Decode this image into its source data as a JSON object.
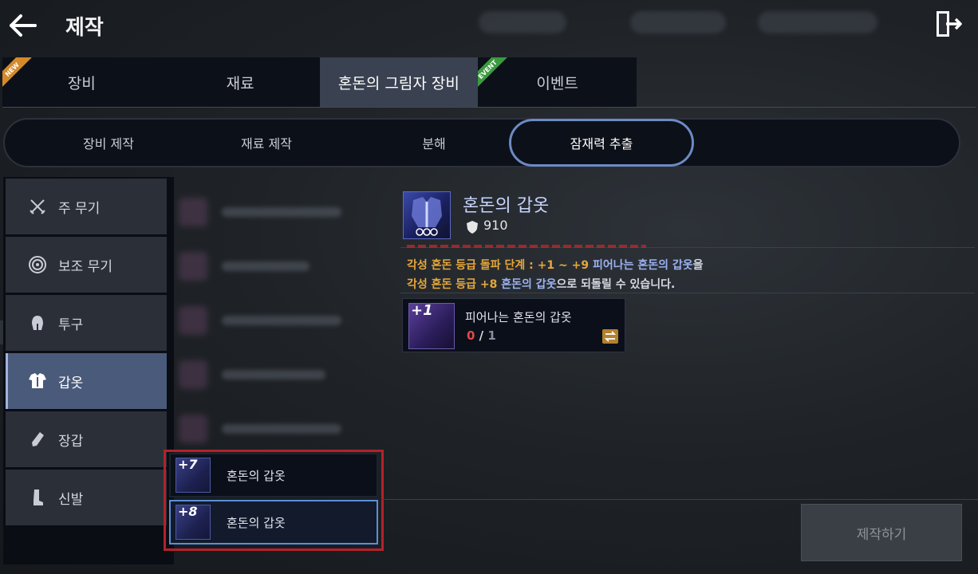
{
  "header": {
    "title": "제작"
  },
  "main_tabs": [
    {
      "label": "장비",
      "ribbon": "NEW"
    },
    {
      "label": "재료",
      "ribbon": ""
    },
    {
      "label": "혼돈의 그림자 장비",
      "ribbon": ""
    },
    {
      "label": "이벤트",
      "ribbon": "EVENT"
    }
  ],
  "sub_tabs": [
    {
      "label": "장비 제작"
    },
    {
      "label": "재료 제작"
    },
    {
      "label": "분해"
    },
    {
      "label": "잠재력 추출"
    }
  ],
  "categories": [
    {
      "label": "주 무기",
      "icon": "crossed-swords-icon"
    },
    {
      "label": "보조 무기",
      "icon": "orb-icon"
    },
    {
      "label": "투구",
      "icon": "helmet-icon"
    },
    {
      "label": "갑옷",
      "icon": "armor-icon"
    },
    {
      "label": "장갑",
      "icon": "gauntlet-icon"
    },
    {
      "label": "신발",
      "icon": "boot-icon"
    }
  ],
  "item_list": [
    {
      "plus": "+7",
      "name": "혼돈의 갑옷"
    },
    {
      "plus": "+8",
      "name": "혼돈의 갑옷"
    }
  ],
  "detail": {
    "name": "혼돈의 갑옷",
    "power": "910",
    "notice": {
      "line1": {
        "a": "각성 혼돈 등급  돌파 단계 : ",
        "b": "+1 ~ +9",
        "c": " 피어나는 혼돈의 갑옷",
        "d": "을"
      },
      "line2": {
        "a": "각성 혼돈 등급 ",
        "b": "+8",
        "c": " 혼돈의 갑옷",
        "d": "으로 되돌릴 수 있습니다."
      }
    },
    "material": {
      "plus": "+1",
      "name": "피어나는 혼돈의 갑옷",
      "have": "0",
      "sep": " / ",
      "need": "1"
    }
  },
  "craft_button": "제작하기",
  "colors": {
    "accent_blue": "#6c8ac4",
    "gold": "#e6a73a",
    "item_name_blue": "#9bb1f0",
    "highlight_red": "#b3222b",
    "count_red": "#e04a4a"
  }
}
